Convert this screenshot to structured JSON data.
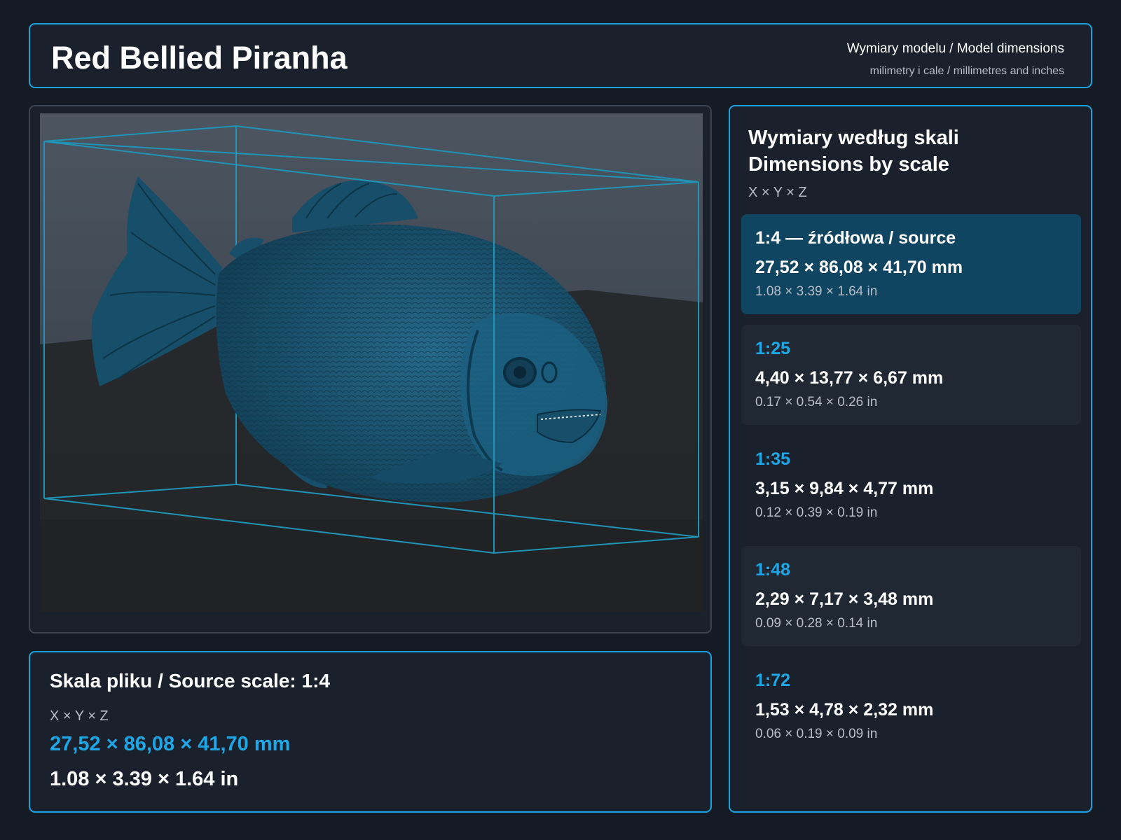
{
  "header": {
    "title": "Red Bellied Piranha",
    "subtitle": "Wymiary modelu / Model dimensions",
    "units": "milimetry i cale / millimetres and inches"
  },
  "viewer": {
    "model_color": "#1c5a78",
    "bbox_color": "#1f94b6"
  },
  "source": {
    "title": "Skala pliku / Source scale: 1:4",
    "axes": "X × Y × Z",
    "mm": "27,52 × 86,08 × 41,70 mm",
    "inches": "1.08 × 3.39 × 1.64 in"
  },
  "scales": {
    "title_pl": "Wymiary według skali",
    "title_en": "Dimensions by scale",
    "axes": "X × Y × Z",
    "items": [
      {
        "label": "1:4  —  źródłowa / source",
        "mm": "27,52 × 86,08 × 41,70 mm",
        "inches": "1.08 × 3.39 × 1.64 in"
      },
      {
        "label": "1:25",
        "mm": "4,40 × 13,77 × 6,67 mm",
        "inches": "0.17 × 0.54 × 0.26 in"
      },
      {
        "label": "1:35",
        "mm": "3,15 × 9,84 × 4,77 mm",
        "inches": "0.12 × 0.39 × 0.19 in"
      },
      {
        "label": "1:48",
        "mm": "2,29 × 7,17 × 3,48 mm",
        "inches": "0.09 × 0.28 × 0.14 in"
      },
      {
        "label": "1:72",
        "mm": "1,53 × 4,78 × 2,32 mm",
        "inches": "0.06 × 0.19 × 0.09 in"
      }
    ]
  },
  "colors": {
    "accent": "#1aa3e0",
    "background": "#151b24",
    "panel": "#1a212c",
    "active_card": "#0f4560"
  }
}
